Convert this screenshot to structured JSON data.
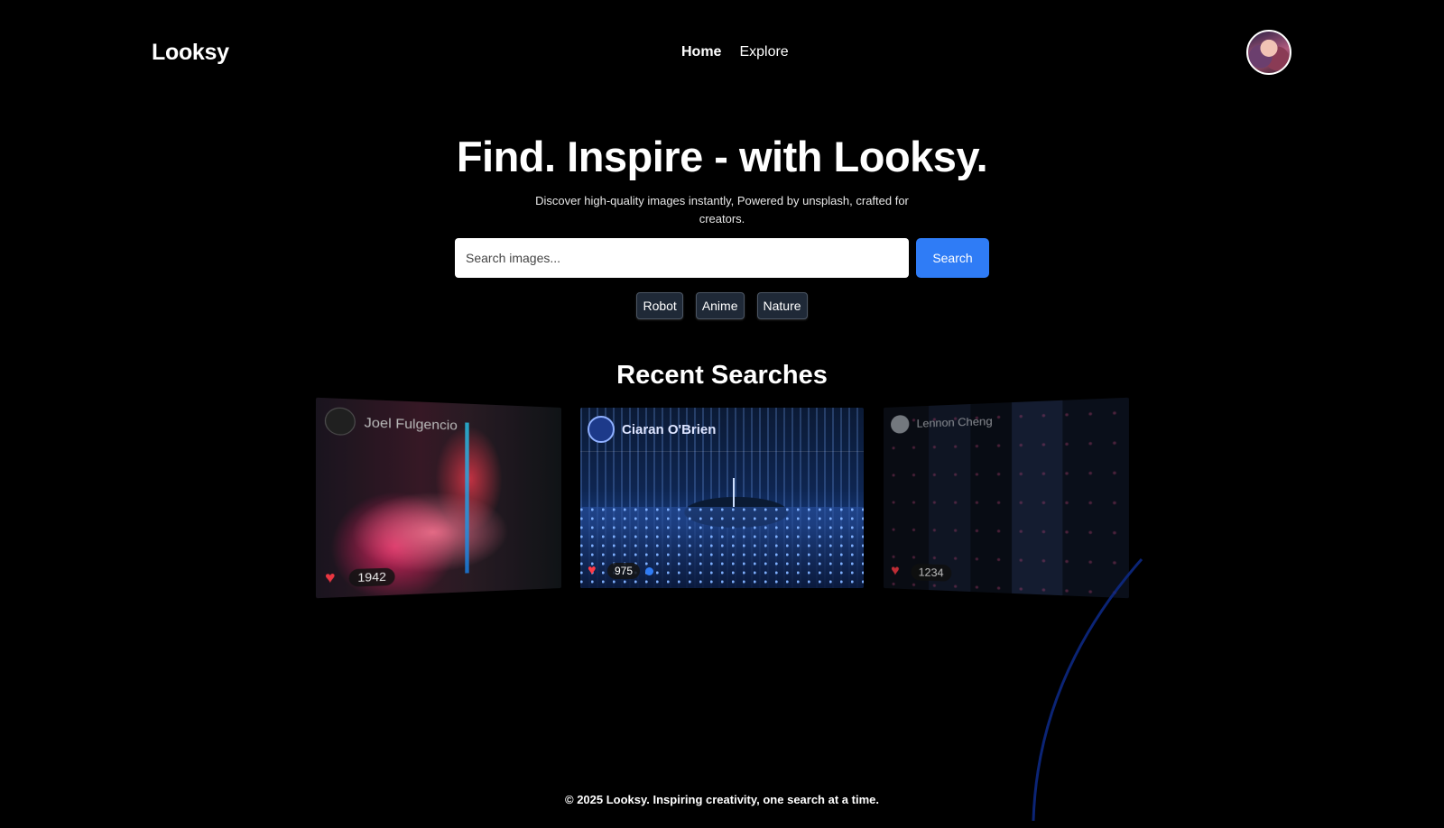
{
  "header": {
    "logo": "Looksy",
    "nav": [
      {
        "label": "Home"
      },
      {
        "label": "Explore"
      }
    ]
  },
  "hero": {
    "title": "Find. Inspire - with Looksy.",
    "subtitle": "Discover high-quality images instantly, Powered by unsplash, crafted for creators."
  },
  "search": {
    "placeholder": "Search images...",
    "button_label": "Search"
  },
  "tags": [
    {
      "label": "Robot"
    },
    {
      "label": "Anime"
    },
    {
      "label": "Nature"
    }
  ],
  "recent": {
    "title": "Recent Searches",
    "cards": [
      {
        "user": "Joel Fulgencio",
        "likes": "1942"
      },
      {
        "user": "Ciaran O'Brien",
        "likes": "975"
      },
      {
        "user": "Lennon Cheng",
        "likes": "1234"
      }
    ]
  },
  "footer": {
    "text": "© 2025 Looksy. Inspiring creativity, one search at a time."
  },
  "colors": {
    "background": "#000000",
    "accent": "#2f7cf6",
    "heart": "#ff3b47",
    "tag_bg": "#1f2937"
  }
}
